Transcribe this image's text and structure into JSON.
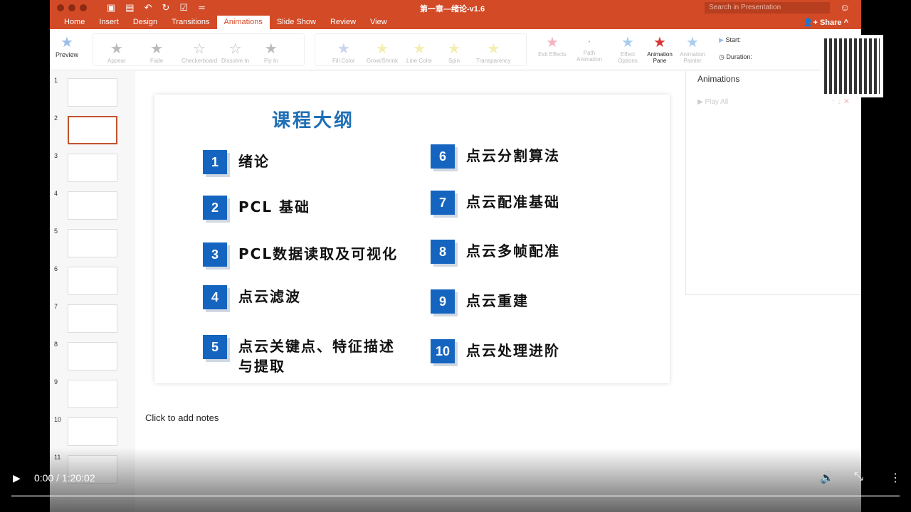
{
  "window": {
    "doc_title": "第一章—绪论-v1.6",
    "search_placeholder": "Search in Presentation",
    "share": "Share"
  },
  "tabs": [
    "Home",
    "Insert",
    "Design",
    "Transitions",
    "Animations",
    "Slide Show",
    "Review",
    "View"
  ],
  "ribbon": {
    "preview": "Preview",
    "entrance": [
      "Appear",
      "Fade",
      "Checkerboard",
      "Dissolve In",
      "Fly In"
    ],
    "emphasis": [
      "Fill Color",
      "Grow/Shrink",
      "Line Color",
      "Spin",
      "Transparency"
    ],
    "exit": "Exit Effects",
    "path": "Path Animation",
    "effect": "Effect Options",
    "pane": "Animation Pane",
    "painter": "Animation Painter",
    "start": "Start:",
    "duration": "Duration:"
  },
  "thumbs": [
    "1",
    "2",
    "3",
    "4",
    "5",
    "6",
    "7",
    "8",
    "9",
    "10",
    "11"
  ],
  "slide": {
    "title": "课程大纲",
    "items": [
      {
        "n": "1",
        "t": "绪论"
      },
      {
        "n": "2",
        "t": "PCL 基础"
      },
      {
        "n": "3",
        "t": "PCL数据读取及可视化"
      },
      {
        "n": "4",
        "t": "点云滤波"
      },
      {
        "n": "5",
        "t": "点云关键点、特征描述与提取"
      },
      {
        "n": "6",
        "t": "点云分割算法"
      },
      {
        "n": "7",
        "t": "点云配准基础"
      },
      {
        "n": "8",
        "t": "点云多帧配准"
      },
      {
        "n": "9",
        "t": "点云重建"
      },
      {
        "n": "10",
        "t": "点云处理进阶"
      }
    ]
  },
  "notes": "Click to add notes",
  "animations": {
    "title": "Animations",
    "play_all": "Play All"
  },
  "player": {
    "time": "0:00 / 1:20:02",
    "progress": 0
  }
}
